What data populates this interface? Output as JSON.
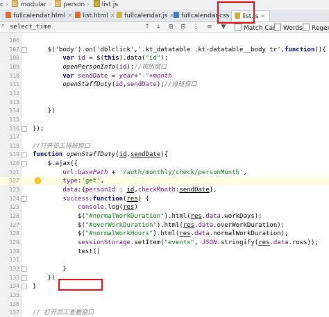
{
  "breadcrumb": {
    "items": [
      "c",
      "modular",
      "person",
      "list.js"
    ]
  },
  "tabs": [
    {
      "label": "fullcalendar.html",
      "type": "html",
      "active": false
    },
    {
      "label": "list.html",
      "type": "html",
      "active": false
    },
    {
      "label": "fullcalendar.js",
      "type": "js",
      "active": false
    },
    {
      "label": "fullcalendar.css",
      "type": "css",
      "active": false
    },
    {
      "label": "list.js",
      "type": "js",
      "active": true
    }
  ],
  "find_bar": {
    "query": "select_time",
    "match_case_label": "Match Case",
    "words_label": "Words",
    "regex_label": "Regex"
  },
  "editor": {
    "current_line": 122,
    "lines": [
      {
        "n": "106",
        "html": ""
      },
      {
        "n": "107",
        "html": "    $('body').on('dblclick','.kt_datatable .kt-datatable__body tr',<span class='kw'>function</span>(){"
      },
      {
        "n": "108",
        "html": "        <span class='kw'>var</span> <span class='prop'>id</span> = $(<span class='kw'>this</span>).data(<span class='str'>\"id\"</span>);"
      },
      {
        "n": "109",
        "html": "        <span class='fn'>openPersonInfo</span>(<span class='prop'>id</span>);<span class='cmt'>//视历窗口</span>"
      },
      {
        "n": "110",
        "html": "        <span class='kw'>var</span> <span class='prop'>sendDate</span> = <span class='glob'>year</span>+<span class='str'>\"-\"</span>+<span class='glob'>month</span>"
      },
      {
        "n": "111",
        "html": "        <span class='fn'>openStaffDuty</span>(<span class='prop'>id</span>,<span class='prop'>sendDate</span>);<span class='cmt'>//排班窗口</span>"
      },
      {
        "n": "112",
        "html": ""
      },
      {
        "n": "113",
        "html": ""
      },
      {
        "n": "114",
        "html": "    })"
      },
      {
        "n": "115",
        "html": ""
      },
      {
        "n": "116",
        "html": "});"
      },
      {
        "n": "117",
        "html": ""
      },
      {
        "n": "118",
        "html": "<span class='cmt'>//打开员工排班窗口</span>"
      },
      {
        "n": "119",
        "html": "<span class='kw'>function</span> <span class='fn'>openStaffDuty</span>(<span class='u'>id</span>,<span class='u'>sendDate</span>){"
      },
      {
        "n": "120",
        "html": "    $.ajax({"
      },
      {
        "n": "121",
        "html": "        <span class='prop'>url</span>:<span class='glob'>basePath</span> + <span class='str'>'/auth/monthly/check/personMonth'</span>,"
      },
      {
        "n": "122",
        "html": "        <span class='prop'>type</span>:<span class='str'>'get'</span>,"
      },
      {
        "n": "123",
        "html": "        <span class='prop'>data</span>:{<span class='prop'>personId</span> : <span class='u'>id</span>,<span class='prop'>checkMonth</span>:<span class='u'>sendDate</span>},"
      },
      {
        "n": "124",
        "html": "        <span class='prop'>success</span>:<span class='kw'>function</span>(<span class='u'>res</span>) {"
      },
      {
        "n": "125",
        "html": "            <span class='prop'>console</span>.log(<span class='u'>res</span>)"
      },
      {
        "n": "126",
        "html": "            $(<span class='str'>\"#normalWorkDuration\"</span>).html(<span class='u'>res</span>.<span class='prop'>data</span>.workDays);"
      },
      {
        "n": "127",
        "html": "            $(<span class='str'>\"#overWorkDuration\"</span>).html(<span class='u'>res</span>.<span class='prop'>data</span>.overWorkDuration);"
      },
      {
        "n": "128",
        "html": "            $(<span class='str'>\"#normalWorkHours\"</span>).html(<span class='u'>res</span>.<span class='prop'>data</span>.normalWorkDuration);"
      },
      {
        "n": "129",
        "html": "            <span class='prop'>sessionStorage</span>.setItem(<span class='str'>\"events\"</span>, <span class='glob'>JSON</span>.stringify(<span class='u'>res</span>.<span class='prop'>data</span>.rows));"
      },
      {
        "n": "130",
        "html": "            test()"
      },
      {
        "n": "131",
        "html": ""
      },
      {
        "n": "132",
        "html": "        }"
      },
      {
        "n": "133",
        "html": "    })"
      },
      {
        "n": "134",
        "html": "}"
      },
      {
        "n": "135",
        "html": ""
      },
      {
        "n": "136",
        "html": ""
      },
      {
        "n": "137",
        "html": "<span class='cmt'>// 打开员工查看窗口</span>"
      }
    ]
  },
  "colors": {
    "highlight": "#e01010",
    "keyword": "#00008b",
    "string": "#067d17",
    "comment": "#808080",
    "property": "#660e7a"
  }
}
